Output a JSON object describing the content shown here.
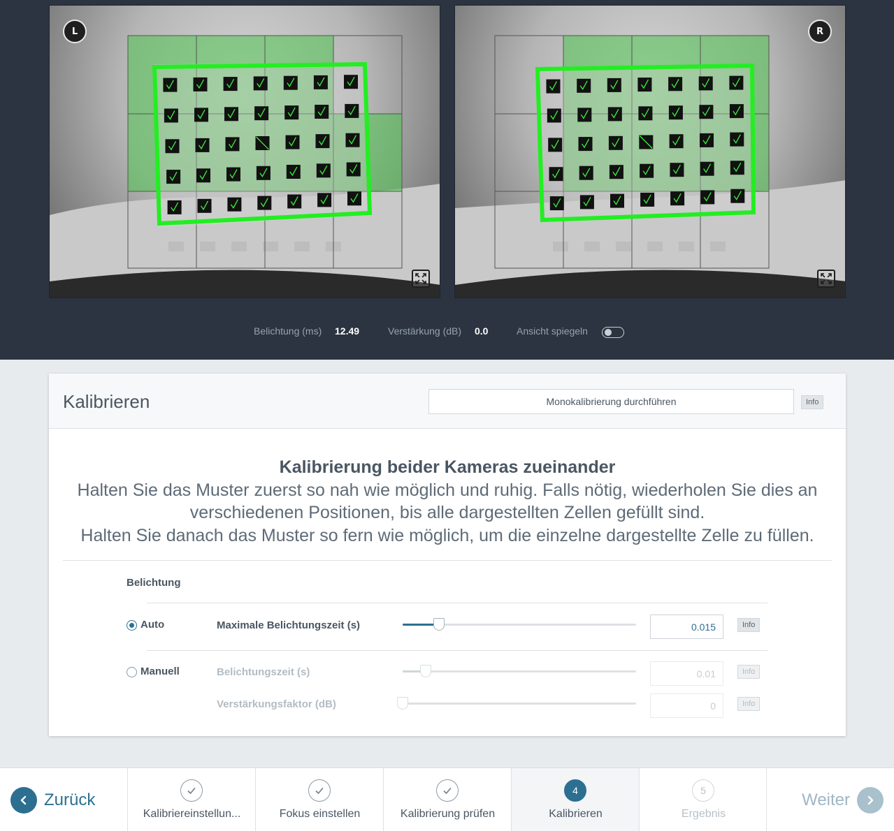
{
  "cameras": {
    "left_badge": "L",
    "right_badge": "R",
    "expand_icon": "expand-icon"
  },
  "camera_params": {
    "exposure_label": "Belichtung (ms)",
    "exposure_value": "12.49",
    "gain_label": "Verstärkung (dB)",
    "gain_value": "0.0",
    "mirror_label": "Ansicht spiegeln",
    "mirror_enabled": false
  },
  "card": {
    "title": "Kalibrieren",
    "mono_button": "Monokalibrierung durchführen",
    "info_label": "Info",
    "instruction_title": "Kalibrierung beider Kameras zueinander",
    "instruction_lines": [
      "Halten Sie das Muster zuerst so nah wie möglich und ruhig. Falls nötig, wiederholen Sie dies an",
      "verschiedenen Positionen, bis alle dargestellten Zellen gefüllt sind.",
      "Halten Sie danach das Muster so fern wie möglich, um die einzelne dargestellte Zelle zu füllen."
    ],
    "exposure_section": "Belichtung",
    "auto": {
      "label": "Auto",
      "selected": true,
      "field_label": "Maximale Belichtungszeit (s)",
      "value": "0.015",
      "slider_fraction": 0.155
    },
    "manual": {
      "label": "Manuell",
      "selected": false,
      "exposure_label": "Belichtungszeit (s)",
      "exposure_value": "0.01",
      "exposure_fraction": 0.1,
      "gain_label": "Verstärkungsfaktor (dB)",
      "gain_value": "0",
      "gain_fraction": 0.0
    }
  },
  "nav": {
    "back_label": "Zurück",
    "next_label": "Weiter",
    "steps": [
      {
        "label": "Kalibriereinstellun...",
        "number": "1",
        "state": "done"
      },
      {
        "label": "Fokus einstellen",
        "number": "2",
        "state": "done"
      },
      {
        "label": "Kalibrierung prüfen",
        "number": "3",
        "state": "done"
      },
      {
        "label": "Kalibrieren",
        "number": "4",
        "state": "active"
      },
      {
        "label": "Ergebnis",
        "number": "5",
        "state": "future"
      }
    ]
  },
  "colors": {
    "accent": "#2d6f90",
    "overlay_green": "#33ff33",
    "header_dark": "#2b3440"
  }
}
